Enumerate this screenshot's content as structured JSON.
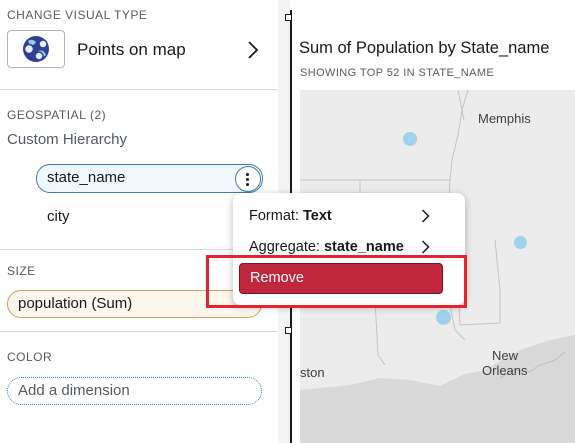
{
  "left_panel": {
    "visual_type_label": "CHANGE VISUAL TYPE",
    "visual_type_value": "Points on map",
    "geospatial_label": "GEOSPATIAL",
    "geospatial_count": "(2)",
    "hierarchy_label": "Custom Hierarchy",
    "field_state": "state_name",
    "field_city": "city",
    "size_label": "SIZE",
    "size_field": "population (Sum)",
    "color_label": "COLOR",
    "color_placeholder": "Add a dimension"
  },
  "chart": {
    "title": "Sum of Population by State_name",
    "subtitle": "SHOWING TOP 52 IN STATE_NAME",
    "map_labels": [
      "Memphis",
      "New",
      "Orleans",
      "ston"
    ]
  },
  "context_menu": {
    "format_prefix": "Format:",
    "format_value": "Text",
    "aggregate_prefix": "Aggregate:",
    "aggregate_value": "state_name",
    "remove_label": "Remove"
  },
  "colors": {
    "accent_blue": "#3b7fb2",
    "remove_red": "#c0263c",
    "highlight_red": "#e4232a",
    "size_orange": "#d5a057",
    "point_blue": "#9fd2ec"
  }
}
